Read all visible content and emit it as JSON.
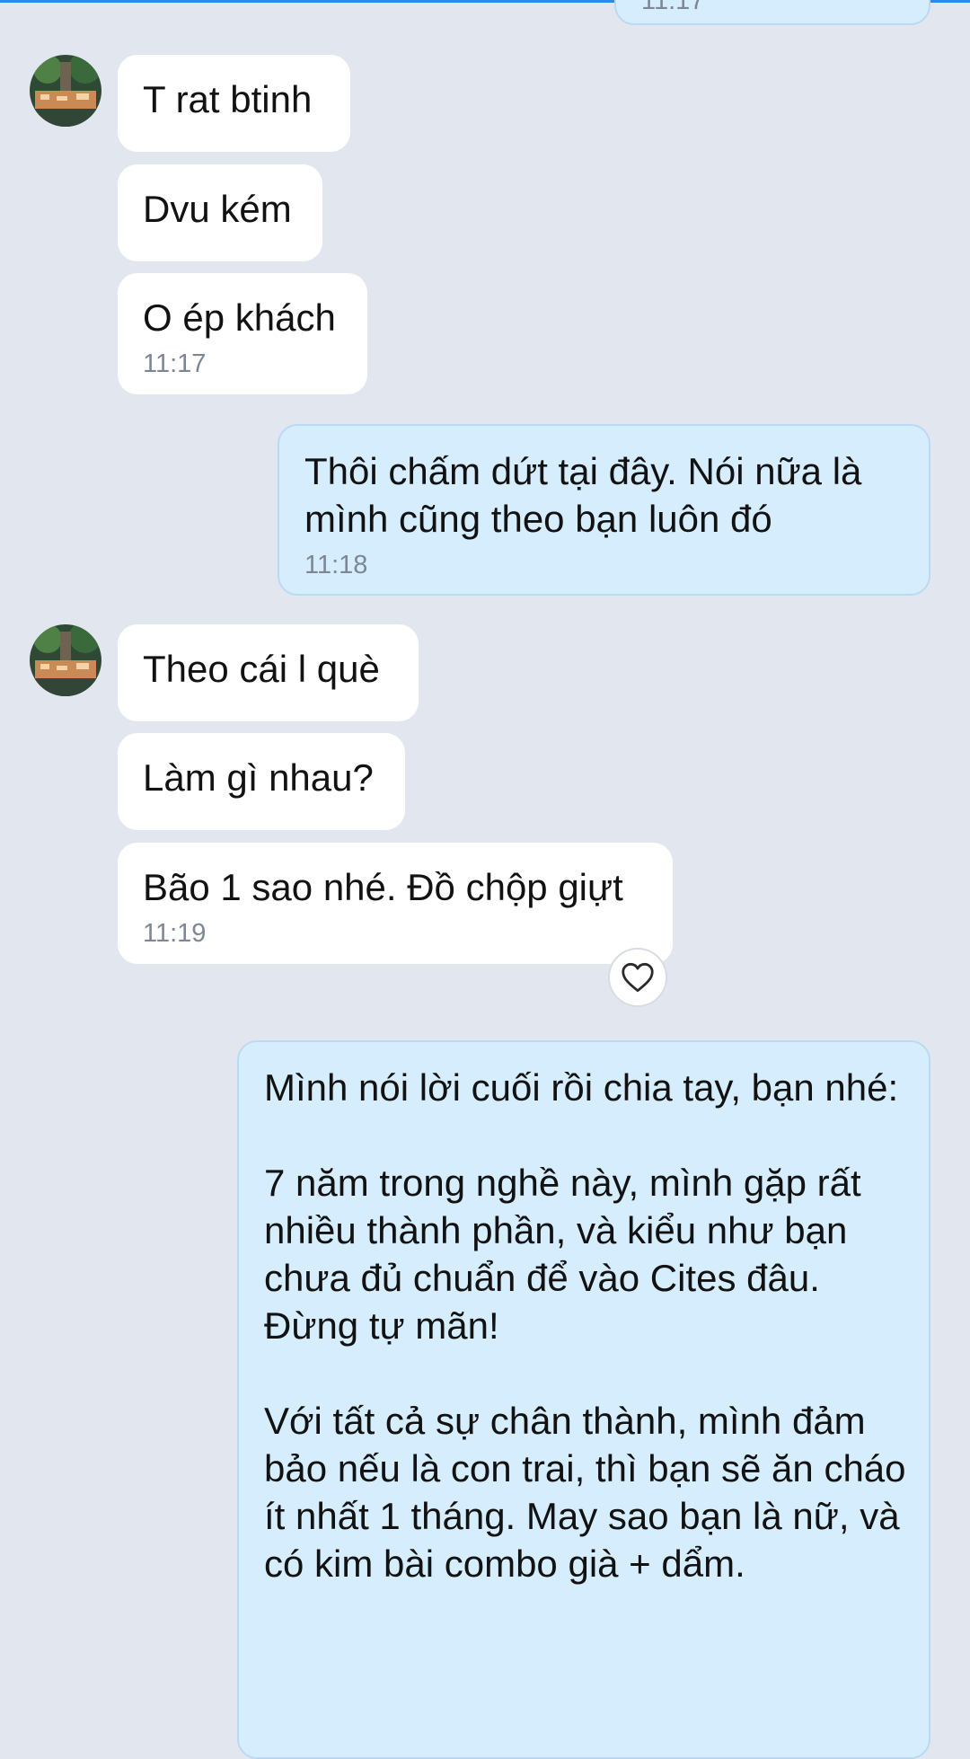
{
  "colors": {
    "background": "#e2e7ef",
    "incoming_bubble": "#ffffff",
    "outgoing_bubble": "#d6edfd",
    "timestamp": "#7d8794",
    "accent": "#2f89e6"
  },
  "messages": [
    {
      "id": "m0",
      "side": "out",
      "text": "",
      "time": "11:17",
      "partial": true
    },
    {
      "id": "m1",
      "side": "in",
      "text": "T rat btinh",
      "time": "",
      "avatar": "contact-avatar"
    },
    {
      "id": "m2",
      "side": "in",
      "text": "Dvu kém",
      "time": ""
    },
    {
      "id": "m3",
      "side": "in",
      "text": "O ép khách",
      "time": "11:17"
    },
    {
      "id": "m4",
      "side": "out",
      "text": "Thôi chấm dứt tại đây. Nói nữa là mình cũng theo bạn luôn đó",
      "time": "11:18"
    },
    {
      "id": "m5",
      "side": "in",
      "text": "Theo cái l què",
      "time": "",
      "avatar": "contact-avatar"
    },
    {
      "id": "m6",
      "side": "in",
      "text": "Làm gì nhau?",
      "time": ""
    },
    {
      "id": "m7",
      "side": "in",
      "text": "Bão 1 sao nhé. Đồ chộp giựt",
      "time": "11:19",
      "reaction_icon": "heart-icon"
    },
    {
      "id": "m8",
      "side": "out",
      "text": "Mình nói lời cuối rồi chia tay, bạn nhé:\n\n7 năm trong nghề này, mình gặp rất nhiều thành phần, và kiểu như bạn chưa đủ chuẩn để vào Cites đâu. Đừng tự mãn!\n\nVới tất cả sự chân thành, mình đảm bảo nếu là con trai, thì bạn sẽ ăn cháo ít nhất 1 tháng. May sao bạn là nữ, và có kim bài combo già + dẩm.",
      "time": ""
    }
  ]
}
